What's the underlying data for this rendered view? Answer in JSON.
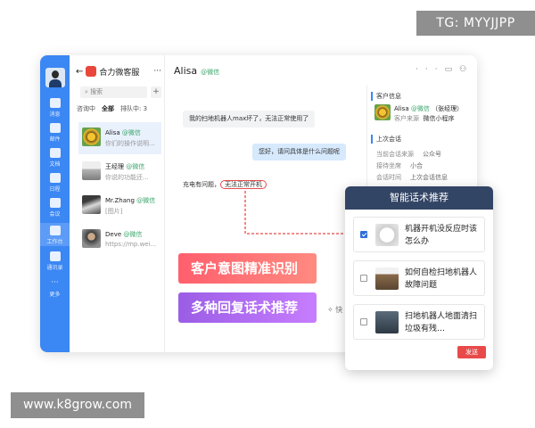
{
  "watermarks": {
    "top": "TG: MYYJJPP",
    "bottom": "www.k8grow.com"
  },
  "rail": {
    "items": [
      "消息",
      "邮件",
      "文档",
      "日程",
      "会议",
      "工作台",
      "通讯录",
      "更多"
    ]
  },
  "convlist": {
    "app_title": "合力微客服",
    "search_placeholder": "搜索",
    "tabs": [
      "咨询中",
      "全部",
      "排队中: 3"
    ],
    "items": [
      {
        "name": "Alisa",
        "tag": "@微信",
        "preview": "你们的操作说明..."
      },
      {
        "name": "王经理",
        "tag": "@微信",
        "preview": "你说的功能还..."
      },
      {
        "name": "Mr.Zhang",
        "tag": "@微信",
        "preview": "[图片]"
      },
      {
        "name": "Deve",
        "tag": "@微信",
        "preview": "https://mp.wei..."
      }
    ]
  },
  "chat": {
    "contact": "Alisa",
    "contact_tag": "@微信",
    "messages": [
      {
        "side": "left",
        "text": "我的扫地机器人max坏了，无法正常使用了"
      },
      {
        "side": "right",
        "text": "您好，请问具体是什么问题呢"
      },
      {
        "side": "left",
        "text": "充电有问题，",
        "highlight": "无法正常开机"
      }
    ]
  },
  "info": {
    "customer_title": "客户信息",
    "customer_name": "Alisa",
    "customer_tag": "@微信",
    "customer_manager": "（张经理）",
    "source_label": "客户来源",
    "source_value": "微信小程序",
    "last_title": "上次会话",
    "rows": [
      {
        "k": "当前会话来源",
        "v": "公众号"
      },
      {
        "k": "接待坐席",
        "v": "小合"
      },
      {
        "k": "会话时间",
        "v": "上次会话信息"
      }
    ]
  },
  "stickers": {
    "intent": "客户意图精准识别",
    "multi": "多种回复话术推荐"
  },
  "smart": {
    "title": "智能话术推荐",
    "items": [
      {
        "text": "机器开机没反应时该怎么办",
        "checked": true
      },
      {
        "text": "如何自检扫地机器人故障问题",
        "checked": false
      },
      {
        "text": "扫地机器人地面清扫垃圾有残…",
        "checked": false
      }
    ],
    "send_label": "发送"
  },
  "colors": {
    "accent": "#3b87f3",
    "send": "#e84a4a",
    "panel_header": "#334565"
  }
}
